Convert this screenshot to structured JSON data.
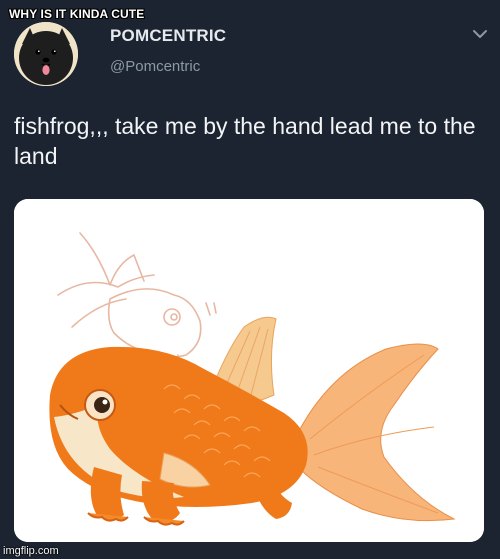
{
  "meme": {
    "caption": "WHY IS IT KINDA CUTE"
  },
  "tweet": {
    "display_name": "POMCENTRIC",
    "handle": "@Pomcentric",
    "text": "fishfrog,,, take me by the hand lead me to the land",
    "menu_icon": "chevron-down-icon",
    "avatar_icon": "black-pomeranian-avatar",
    "media": "goldfish-frog-illustration"
  },
  "footer": {
    "watermark": "imgflip.com"
  },
  "colors": {
    "background": "#1c2431",
    "name": "#e6e9ed",
    "handle": "#8b98a5",
    "text": "#f2f4f6",
    "fish_orange": "#f07a1a"
  }
}
